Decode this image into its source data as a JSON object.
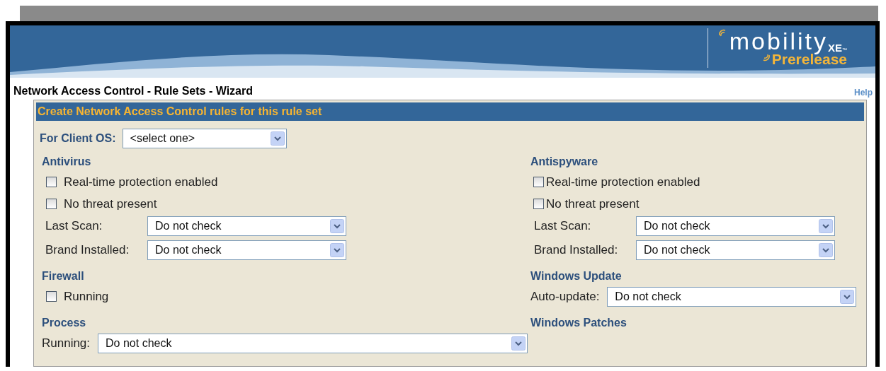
{
  "logo": {
    "name": "mobility",
    "edition": "XE",
    "trademark": "™",
    "tagline": "Prerelease"
  },
  "page_title": "Network Access Control - Rule Sets - Wizard",
  "help_link": "Help",
  "panel": {
    "title": "Create Network Access Control rules for this rule set",
    "client_os": {
      "label": "For Client OS:",
      "value": "<select one>"
    },
    "sections": [
      {
        "heading": "Antivirus",
        "items": [
          {
            "kind": "checkbox",
            "label": "Real-time protection enabled",
            "checked": false
          },
          {
            "kind": "checkbox",
            "label": "No threat present",
            "checked": false
          },
          {
            "kind": "select",
            "label": "Last Scan:",
            "value": "Do not check"
          },
          {
            "kind": "select",
            "label": "Brand Installed:",
            "value": "Do not check"
          }
        ]
      },
      {
        "heading": "Antispyware",
        "items": [
          {
            "kind": "checkbox",
            "label": "Real-time protection enabled",
            "checked": false
          },
          {
            "kind": "checkbox",
            "label": "No threat present",
            "checked": false
          },
          {
            "kind": "select",
            "label": "Last Scan:",
            "value": "Do not check"
          },
          {
            "kind": "select",
            "label": "Brand Installed:",
            "value": "Do not check"
          }
        ]
      },
      {
        "heading": "Firewall",
        "items": [
          {
            "kind": "checkbox",
            "label": "Running",
            "checked": false
          }
        ]
      },
      {
        "heading": "Windows Update",
        "items": [
          {
            "kind": "wideselect",
            "label": "Auto-update:",
            "value": "Do not check"
          }
        ]
      },
      {
        "heading": "Process",
        "items": [
          {
            "kind": "wideselect",
            "label": "Running:",
            "value": "Do not check"
          }
        ]
      },
      {
        "heading": "Windows Patches"
      }
    ]
  }
}
